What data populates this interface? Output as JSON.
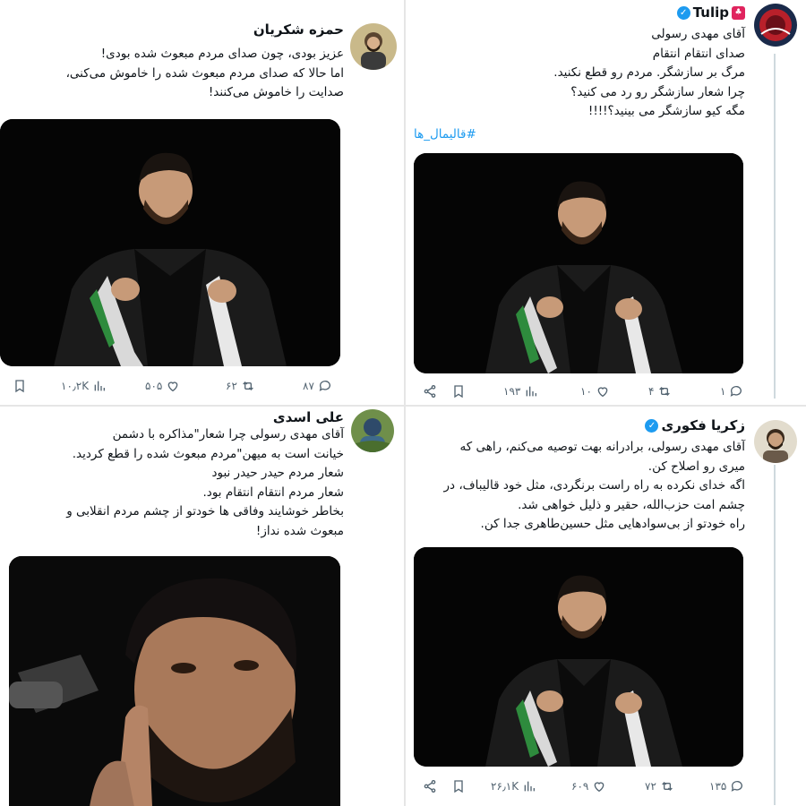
{
  "tweets": [
    {
      "id": "t1",
      "author": "حمزه شکریان",
      "lines": [
        "عزیز بودی، چون صدای مردم مبعوث شده بودی!",
        "اما حالا که صدای مردم مبعوث شده را خاموش می‌کنی،",
        "صدایت را خاموش می‌کنند!"
      ],
      "stats": {
        "replies": "۸۷",
        "retweets": "۶۲",
        "likes": "۵۰۵",
        "views": "۱۰٫۲K"
      }
    },
    {
      "id": "t2",
      "author": "Tulip",
      "verified": true,
      "lines": [
        "آقای مهدی رسولی",
        "صدای انتقام انتقام",
        "مرگ بر سازشگر. مردم رو قطع نکنید.",
        "چرا شعار سازشگر رو رد می کنید؟",
        "مگه کیو سازشگر می بینید؟!!!!"
      ],
      "hashtag": "#قالیمال_ها",
      "stats": {
        "replies": "۱",
        "retweets": "۴",
        "likes": "۱۰",
        "views": "۱۹۳"
      }
    },
    {
      "id": "t3",
      "author": "علی اسدی",
      "lines": [
        "آقای مهدی رسولی چرا شعار\"مذاکره با دشمن",
        "خیانت است به میهن\"مردم مبعوث شده را قطع کردید.",
        "شعار مردم حیدر حیدر نبود",
        "شعار مردم انتقام انتقام بود.",
        "بخاطر خوشایند وفاقی ها خودتو از چشم مردم انقلابی و",
        "مبعوث شده نداز!"
      ]
    },
    {
      "id": "t4",
      "author": "زکریا فکوری",
      "verified": true,
      "lines": [
        "آقای مهدی رسولی، برادرانه بهت توصیه می‌کنم، راهی که",
        "میری رو اصلاح کن.",
        "اگه خدای نکرده به راه راست برنگردی، مثل خود قالیباف، در",
        "چشم امت حزب‌الله، حقیر و ذلیل خواهی شد.",
        "راه خودتو از بی‌سوادهایی مثل حسین‌طاهری جدا کن."
      ],
      "stats": {
        "replies": "۱۳۵",
        "retweets": "۷۲",
        "likes": "۶۰۹",
        "views": "۲۶٫۱K"
      }
    }
  ],
  "colors": {
    "accent": "#1d9bf0",
    "text": "#0f1419",
    "muted": "#536471",
    "verified": "#1d9bf0"
  },
  "icons": [
    "reply-icon",
    "retweet-icon",
    "like-icon",
    "views-icon",
    "bookmark-icon",
    "share-icon",
    "verified-icon"
  ]
}
